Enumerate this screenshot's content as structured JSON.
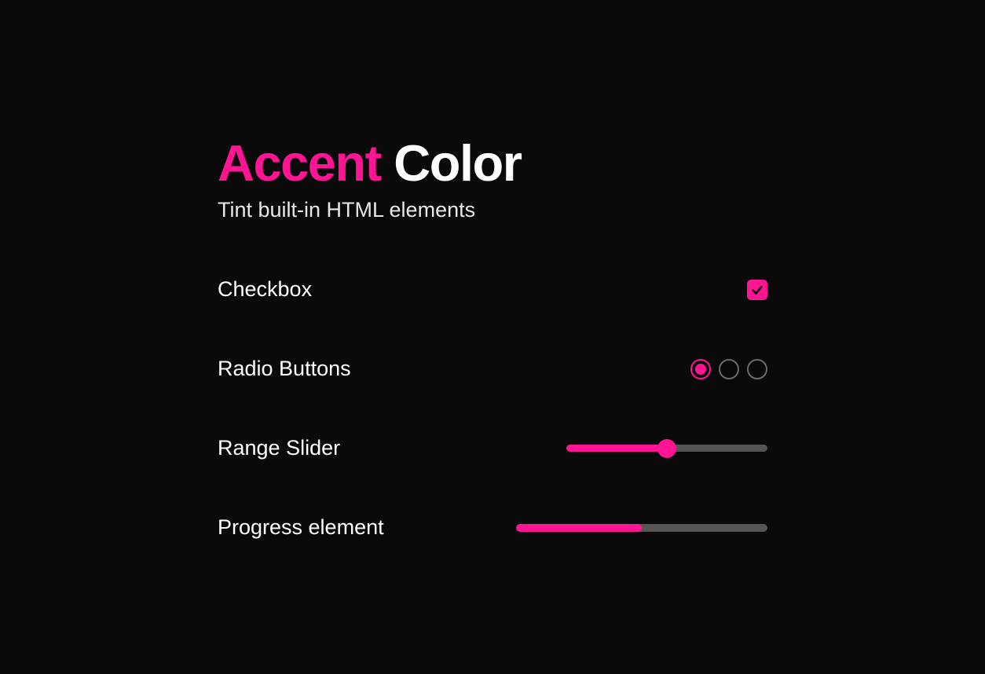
{
  "accent_color": "#ff1493",
  "title": {
    "accent_word": "Accent",
    "rest": " Color"
  },
  "subtitle": "Tint built-in HTML elements",
  "rows": {
    "checkbox": {
      "label": "Checkbox",
      "checked": true
    },
    "radio": {
      "label": "Radio Buttons",
      "options": 3,
      "selected_index": 0
    },
    "slider": {
      "label": "Range Slider",
      "value": 50,
      "min": 0,
      "max": 100
    },
    "progress": {
      "label": "Progress element",
      "value": 50,
      "max": 100
    }
  }
}
